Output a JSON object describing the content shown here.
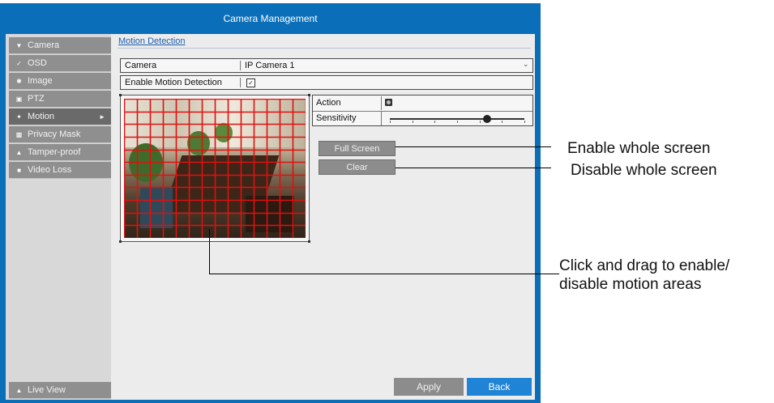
{
  "window": {
    "title": "Camera Management"
  },
  "sidebar": {
    "items": [
      {
        "label": "Camera",
        "icon": "camera-icon",
        "active": false
      },
      {
        "label": "OSD",
        "icon": "osd-icon",
        "active": false
      },
      {
        "label": "Image",
        "icon": "image-icon",
        "active": false
      },
      {
        "label": "PTZ",
        "icon": "ptz-icon",
        "active": false
      },
      {
        "label": "Motion",
        "icon": "motion-icon",
        "active": true
      },
      {
        "label": "Privacy Mask",
        "icon": "privacy-mask-icon",
        "active": false
      },
      {
        "label": "Tamper-proof",
        "icon": "tamper-proof-icon",
        "active": false
      },
      {
        "label": "Video Loss",
        "icon": "video-loss-icon",
        "active": false
      }
    ],
    "live_view": "Live View"
  },
  "content": {
    "section_title": "Motion Detection",
    "camera_label": "Camera",
    "camera_value": "IP Camera 1",
    "enable_label": "Enable Motion Detection",
    "enable_checked": true,
    "action_label": "Action",
    "sensitivity_label": "Sensitivity",
    "sensitivity_level": 0.72,
    "full_screen_label": "Full Screen",
    "clear_label": "Clear",
    "apply_label": "Apply",
    "back_label": "Back"
  },
  "annotations": {
    "full_screen": "Enable whole screen",
    "clear": "Disable whole screen",
    "drag_line1": "Click and drag to enable/",
    "drag_line2": "disable motion areas"
  },
  "colors": {
    "title_bar": "#0a6fb8",
    "grid": "#e01010",
    "back_button": "#1f84d6"
  }
}
